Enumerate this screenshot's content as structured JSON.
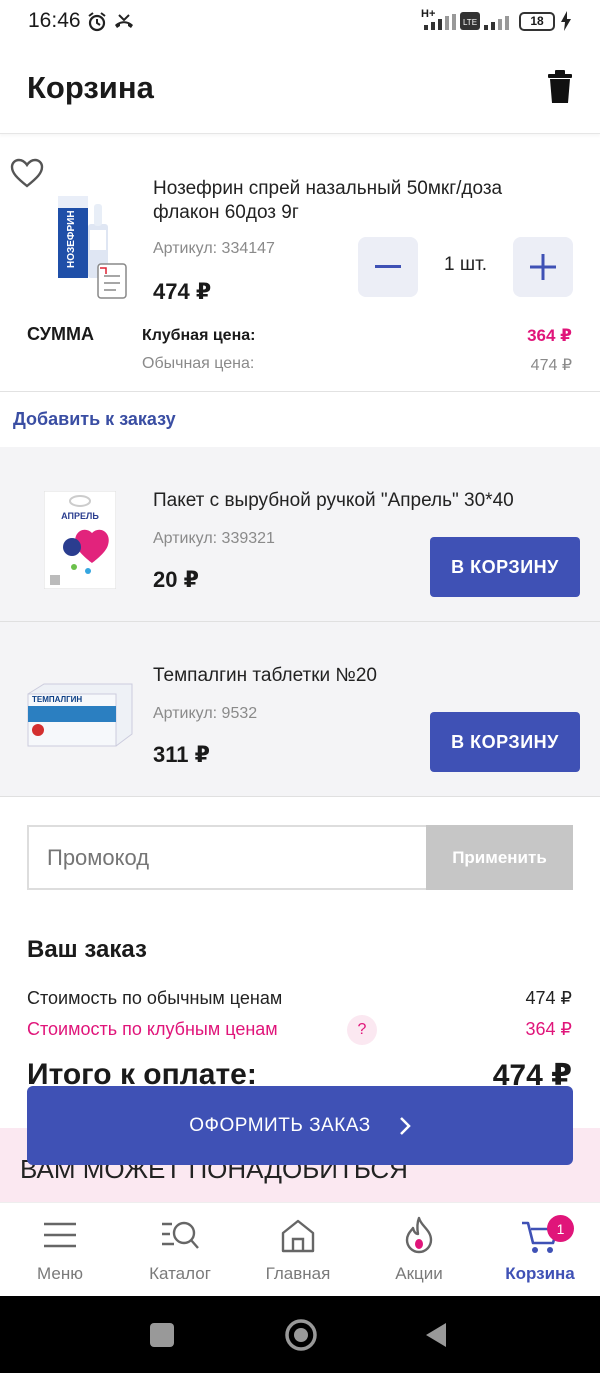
{
  "status_bar": {
    "time": "16:46",
    "network": "H+",
    "battery": "18"
  },
  "header": {
    "title": "Корзина",
    "delete_icon": "trash-icon"
  },
  "cart_item": {
    "name": "Нозефрин спрей назальный 50мкг/доза флакон 60доз 9г",
    "article": "Артикул: 334147",
    "price": "474 ₽",
    "quantity": "1 шт.",
    "sum_label": "СУММА",
    "club_price_label": "Клубная цена:",
    "club_price": "364 ₽",
    "regular_price_label": "Обычная цена:",
    "regular_price": "474 ₽",
    "package_label": "НОЗЕФРИН"
  },
  "add_to_order": {
    "label": "Добавить к заказу"
  },
  "suggestions": [
    {
      "name": "Пакет с вырубной ручкой \"Апрель\" 30*40",
      "article": "Артикул: 339321",
      "price": "20 ₽",
      "button": "В КОРЗИНУ",
      "logo": "АПРЕЛЬ"
    },
    {
      "name": "Темпалгин таблетки №20",
      "article": "Артикул: 9532",
      "price": "311 ₽",
      "button": "В КОРЗИНУ",
      "logo": "ТЕМПАЛГИН"
    }
  ],
  "promo": {
    "placeholder": "Промокод",
    "apply": "Применить"
  },
  "order": {
    "title": "Ваш заказ",
    "regular_label": "Стоимость по обычным ценам",
    "regular_value": "474 ₽",
    "club_label": "Стоимость по клубным ценам",
    "club_value": "364 ₽",
    "help": "?",
    "total_label": "Итого к оплате:",
    "total_value": "474 ₽"
  },
  "checkout_button": "ОФОРМИТЬ ЗАКАЗ",
  "recommendations_title": "ВАМ МОЖЕТ ПОНАДОБИТЬСЯ",
  "bottom_nav": {
    "items": [
      {
        "label": "Меню",
        "icon": "menu-icon"
      },
      {
        "label": "Каталог",
        "icon": "catalog-search-icon"
      },
      {
        "label": "Главная",
        "icon": "home-icon"
      },
      {
        "label": "Акции",
        "icon": "fire-icon"
      },
      {
        "label": "Корзина",
        "icon": "cart-icon"
      }
    ],
    "cart_badge": "1"
  },
  "colors": {
    "accent": "#3f51b5",
    "club": "#e0157a",
    "muted": "#8a8a8a"
  }
}
